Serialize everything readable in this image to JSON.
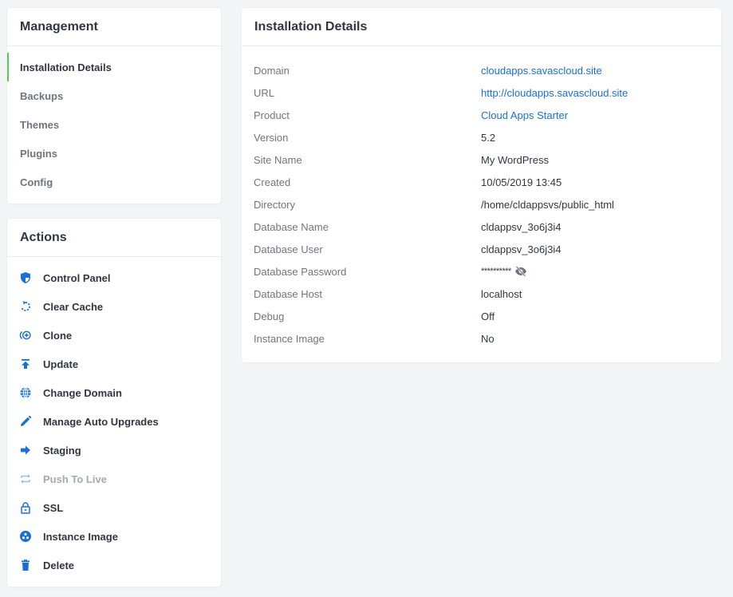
{
  "management": {
    "title": "Management",
    "items": [
      {
        "label": "Installation Details",
        "active": true
      },
      {
        "label": "Backups",
        "active": false
      },
      {
        "label": "Themes",
        "active": false
      },
      {
        "label": "Plugins",
        "active": false
      },
      {
        "label": "Config",
        "active": false
      }
    ]
  },
  "actions": {
    "title": "Actions",
    "items": [
      {
        "label": "Control Panel",
        "icon": "shield-icon"
      },
      {
        "label": "Clear Cache",
        "icon": "refresh-dashed-icon"
      },
      {
        "label": "Clone",
        "icon": "clone-plus-icon"
      },
      {
        "label": "Update",
        "icon": "upload-icon"
      },
      {
        "label": "Change Domain",
        "icon": "globe-icon"
      },
      {
        "label": "Manage Auto Upgrades",
        "icon": "pencil-icon"
      },
      {
        "label": "Staging",
        "icon": "arrow-right-icon"
      },
      {
        "label": "Push To Live",
        "icon": "repeat-icon",
        "disabled": true
      },
      {
        "label": "SSL",
        "icon": "lock-icon"
      },
      {
        "label": "Instance Image",
        "icon": "instance-image-icon"
      },
      {
        "label": "Delete",
        "icon": "trash-icon"
      }
    ]
  },
  "details": {
    "title": "Installation Details",
    "rows": [
      {
        "label": "Domain",
        "value": "cloudapps.savascloud.site",
        "link": true
      },
      {
        "label": "URL",
        "value": "http://cloudapps.savascloud.site",
        "link": true
      },
      {
        "label": "Product",
        "value": "Cloud Apps Starter",
        "link": true
      },
      {
        "label": "Version",
        "value": "5.2"
      },
      {
        "label": "Site Name",
        "value": "My WordPress"
      },
      {
        "label": "Created",
        "value": "10/05/2019 13:45"
      },
      {
        "label": "Directory",
        "value": "/home/cldappsvs/public_html"
      },
      {
        "label": "Database Name",
        "value": "cldappsv_3o6j3i4"
      },
      {
        "label": "Database User",
        "value": "cldappsv_3o6j3i4"
      },
      {
        "label": "Database Password",
        "value": "**********",
        "masked": true
      },
      {
        "label": "Database Host",
        "value": "localhost"
      },
      {
        "label": "Debug",
        "value": "Off"
      },
      {
        "label": "Instance Image",
        "value": "No"
      }
    ]
  },
  "colors": {
    "accent": "#1a6fd6",
    "active_indicator": "#5ac85a",
    "background": "#f3f4f6"
  }
}
